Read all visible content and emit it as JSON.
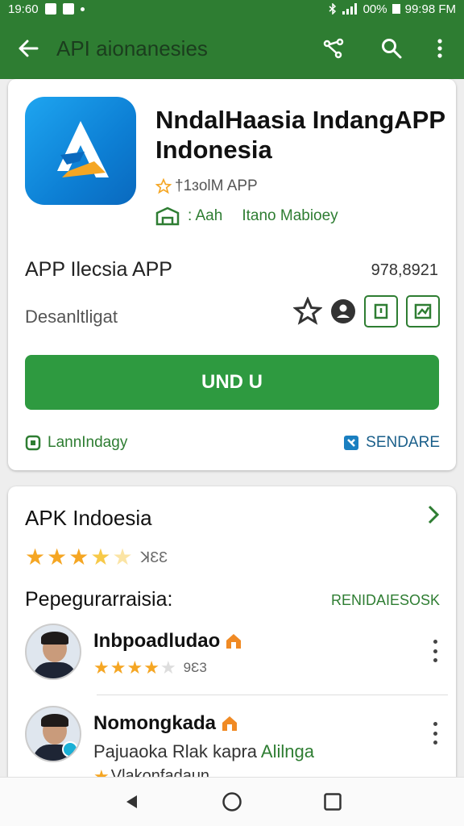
{
  "status_bar": {
    "time": "19:60",
    "battery": "00%",
    "clock_right": "99:98 FM"
  },
  "toolbar": {
    "title": "API aionanesies",
    "icons": [
      "back-arrow-icon",
      "share-icon",
      "search-icon",
      "more-vert-icon"
    ]
  },
  "app": {
    "name_line1": "NndalHaasia IndangAPP",
    "name_line2": "Indonesia",
    "developer": "†1ɜolM APP",
    "category_left": ": Aah",
    "category_right": "Itano Mabioey",
    "subtitle": "APP Ilecsia APP",
    "number": "978,8921",
    "developer2": "Desanltligat",
    "install_label": "UND U",
    "link_left": "LannIndagy",
    "link_right": "SENDARE",
    "colors": {
      "primary": "#2e7d32",
      "button": "#2e9a40",
      "icon_bg": "#1ea5f0"
    }
  },
  "reviews": {
    "title": "APK Indoesia",
    "rating_count": "ꓘƐƐ",
    "rating_value": 3.5,
    "label": "Pepegurarraisia:",
    "action": "RENIDAIESOSK",
    "items": [
      {
        "name": "Inbpoadludao",
        "rating_value": 3.5,
        "rating_count": "9Ɛ3"
      },
      {
        "name": "Nomongkada",
        "text_plain": "Pajuaoka Rlak kapra ",
        "text_highlight": "Alilnga",
        "sub": "Vlakonfadaun"
      }
    ]
  },
  "nav": {
    "icons": [
      "back-triangle-icon",
      "home-circle-icon",
      "recents-square-icon"
    ]
  }
}
